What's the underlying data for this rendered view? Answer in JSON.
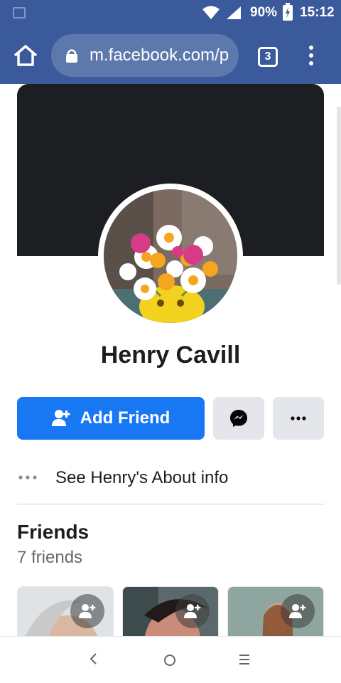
{
  "status": {
    "battery_pct": "90%",
    "time": "15:12",
    "icons": [
      "image-thumbnail-icon",
      "wifi-icon",
      "signal-icon",
      "battery-charging-icon"
    ]
  },
  "browser": {
    "url": "m.facebook.com/p",
    "tab_count": "3",
    "icons": [
      "home-icon",
      "lock-icon",
      "overflow-menu-icon"
    ]
  },
  "profile": {
    "name": "Henry Cavill",
    "add_friend_label": "Add Friend",
    "about_label": "See Henry's About info"
  },
  "friends": {
    "title": "Friends",
    "count_label": "7 friends"
  },
  "colors": {
    "brand_bar": "#3a5a9b",
    "primary_button": "#1877f2",
    "secondary_button": "#e4e6eb",
    "cover": "#1c1e21"
  }
}
